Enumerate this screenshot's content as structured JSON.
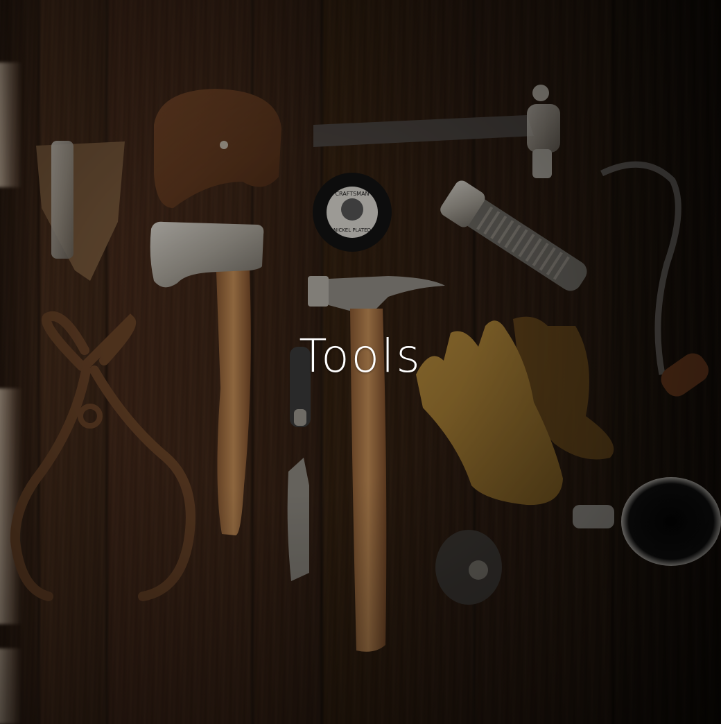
{
  "tile": {
    "title": "Tools"
  },
  "colors": {
    "title_text": "#ffffff",
    "wood_dark": "#1a120c",
    "wood_mid": "#3a2416"
  },
  "image": {
    "subject": "tools-on-wood-photo",
    "objects": [
      "axe-sheath",
      "leather-pouch",
      "ball-peen-hammer",
      "tape-measure",
      "flashlight",
      "hand-axe",
      "claw-hammer",
      "ice-tongs",
      "pocket-knife",
      "utility-knife",
      "work-gloves",
      "hook-tool",
      "metal-mug",
      "oil-can"
    ],
    "tape_measure_label_top": "CRAFTSMAN",
    "tape_measure_label_bottom": "NICKEL PLATED"
  }
}
